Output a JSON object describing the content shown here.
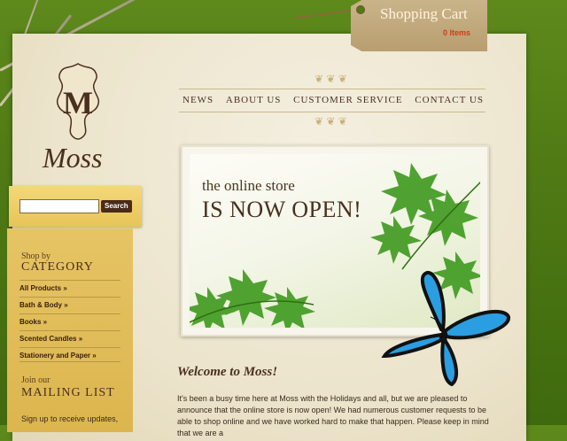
{
  "cart": {
    "title": "Shopping Cart",
    "count": "0 Items"
  },
  "logo": {
    "monogram": "M",
    "word": "Moss"
  },
  "nav": [
    "NEWS",
    "ABOUT US",
    "CUSTOMER SERVICE",
    "CONTACT US"
  ],
  "search": {
    "placeholder": "",
    "button_label": "Search"
  },
  "category": {
    "small": "Shop by",
    "big": "CATEGORY",
    "items": [
      "All Products »",
      "Bath & Body »",
      "Books »",
      "Scented Candles »",
      "Stationery and Paper »"
    ]
  },
  "mailing": {
    "small": "Join our",
    "big": "MAILING LIST",
    "text": "Sign up to receive updates,"
  },
  "banner": {
    "line1": "the online store",
    "line2": "IS NOW OPEN!"
  },
  "welcome": {
    "title": "Welcome to Moss!",
    "body": "It's been a busy time here at Moss with the Holidays and all, but we are pleased to announce that the online store is now open! We had numerous customer requests to be able to shop online and we have worked hard to make that happen. Please keep in mind that we are a"
  },
  "colors": {
    "accent": "#4a2f1e",
    "background": "#4f7a14",
    "paper": "#ece4cc",
    "cart_count": "#d23b16",
    "butterfly_blue": "#2a9ee0"
  }
}
